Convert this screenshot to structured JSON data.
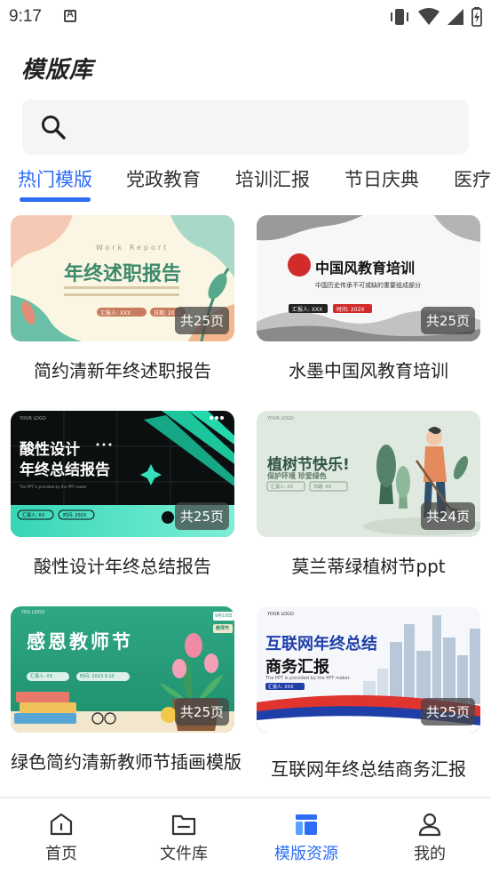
{
  "status_bar": {
    "time": "9:17"
  },
  "page_title": "模版库",
  "search": {
    "placeholder": ""
  },
  "tabs": [
    {
      "label": "热门模版",
      "active": true
    },
    {
      "label": "党政教育",
      "active": false
    },
    {
      "label": "培训汇报",
      "active": false
    },
    {
      "label": "节日庆典",
      "active": false
    },
    {
      "label": "医疗",
      "active": false
    }
  ],
  "templates": [
    {
      "title": "简约清新年终述职报告",
      "pages": "共25页",
      "thumb": {
        "heading": "年终述职报告",
        "kicker": "Work Report",
        "tag1": "汇报人: XXX",
        "tag2": "日期: 202X"
      }
    },
    {
      "title": "水墨中国风教育培训",
      "pages": "共25页",
      "thumb": {
        "heading": "中国风教育培训",
        "sub": "中国历史传承不可或缺的重要组成部分",
        "tag1": "汇报人: XXX",
        "tag2": "时间: 202X"
      }
    },
    {
      "title": "酸性设计年终总结报告",
      "pages": "共25页",
      "thumb": {
        "logo": "YOUR LOGO",
        "heading1": "酸性设计",
        "heading2": "年终总结报告",
        "sub": "The PPT is provided by the PPT maker",
        "tag1": "汇报人: XX",
        "tag2": "时间: 202X"
      }
    },
    {
      "title": "莫兰蒂绿植树节ppt",
      "pages": "共24页",
      "thumb": {
        "logo": "YOUR LOGO",
        "heading": "植树节快乐!",
        "sub": "保护环境  珍爱绿色",
        "tag1": "汇报人: XX",
        "tag2": "日期: XX"
      }
    },
    {
      "title": "绿色简约清新教师节插画模版",
      "pages": "共25页",
      "thumb": {
        "logo": "YOU LOGO",
        "heading": "感恩教师节",
        "date": "9月10日",
        "badge": "教师节",
        "tag1": "汇报人: XX",
        "tag2": "时间: 2023.9.10"
      }
    },
    {
      "title": "互联网年终总结商务汇报",
      "pages": "共25页",
      "thumb": {
        "logo": "YOUR LOGO",
        "heading1": "互联网年终总结",
        "heading2": "商务汇报",
        "sub": "The PPT is provided by the PPT maker.",
        "tag1": "汇报人: XXX"
      }
    }
  ],
  "bottom_nav": [
    {
      "label": "首页",
      "icon": "home-icon",
      "active": false
    },
    {
      "label": "文件库",
      "icon": "folder-icon",
      "active": false
    },
    {
      "label": "模版资源",
      "icon": "templates-icon",
      "active": true
    },
    {
      "label": "我的",
      "icon": "profile-icon",
      "active": false
    }
  ],
  "colors": {
    "accent": "#2d6df6",
    "text": "#222222"
  }
}
